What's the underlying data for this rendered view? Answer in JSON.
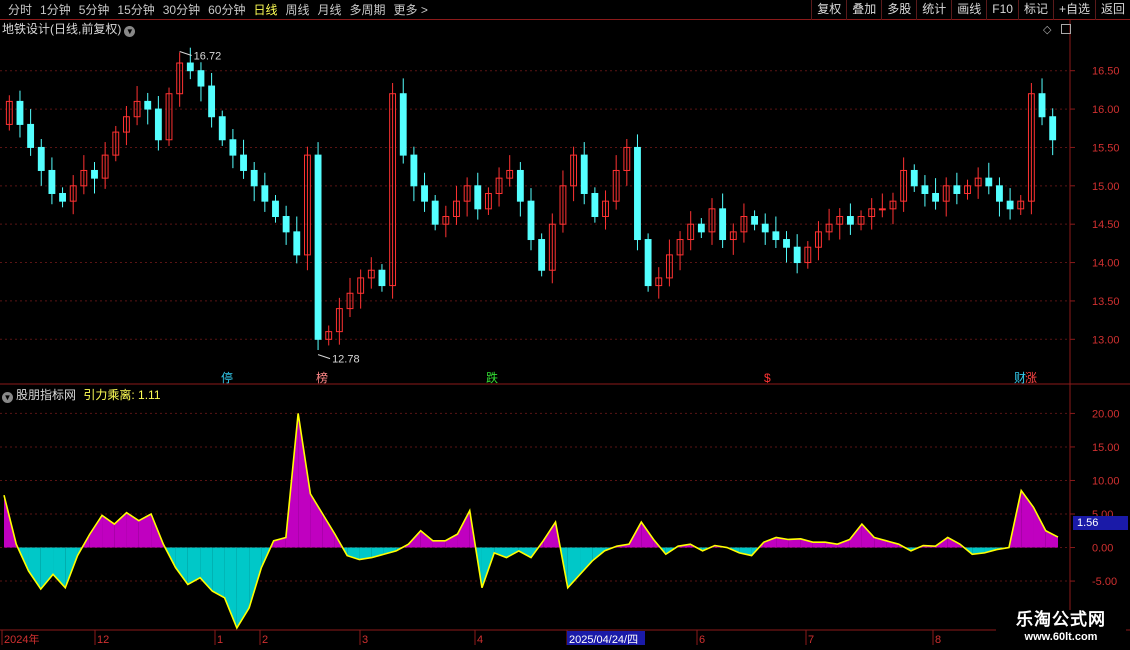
{
  "toolbar": {
    "period_tabs": [
      "分时",
      "1分钟",
      "5分钟",
      "15分钟",
      "30分钟",
      "60分钟",
      "日线",
      "周线",
      "月线",
      "多周期",
      "更多 >"
    ],
    "active_tab": "日线",
    "actions": [
      "复权",
      "叠加",
      "多股",
      "统计",
      "画线",
      "F10",
      "标记",
      "+自选",
      "返回"
    ]
  },
  "main_pane": {
    "title": "地铁设计(日线,前复权)",
    "price_ticks": [
      "16.50",
      "16.00",
      "15.50",
      "15.00",
      "14.50",
      "14.00",
      "13.50",
      "13.00"
    ],
    "high_marker": "16.72",
    "low_marker": "12.78",
    "event_markers": [
      {
        "text": "停",
        "color": "#33ccee"
      },
      {
        "text": "榜",
        "color": "#ff8888"
      },
      {
        "text": "跌",
        "color": "#33dd33"
      },
      {
        "text": "$",
        "color": "#ff3333"
      },
      {
        "text": "财",
        "color": "#33ccee"
      },
      {
        "text": "涨",
        "color": "#ff4444"
      }
    ],
    "colors": {
      "up": "#ff3232",
      "down": "#54ffff"
    }
  },
  "indicator_pane": {
    "source": "股朋指标网",
    "name": "引力乘离:",
    "value": "1.11",
    "current_box": "1.56",
    "ticks": [
      "20.00",
      "15.00",
      "10.00",
      "5.00",
      "0.00",
      "-5.00"
    ],
    "colors": {
      "positive_fill": "#c000c0",
      "negative_fill": "#00c8c8",
      "line": "#ffff00"
    }
  },
  "date_axis": {
    "labels": [
      "2024年",
      "12",
      "1",
      "2",
      "3",
      "4",
      "2025/04/24/四",
      "6",
      "7",
      "8"
    ]
  },
  "watermark": {
    "title": "乐淘公式网",
    "url": "www.60lt.com"
  },
  "chart_data": [
    {
      "type": "candlestick",
      "title": "地铁设计(日线,前复权)",
      "ylim": [
        12.6,
        16.9
      ],
      "series": [
        {
          "values": [
            16.1,
            15.8,
            15.5,
            15.2,
            14.9,
            14.8,
            15.0,
            15.2,
            15.1,
            15.4,
            15.7,
            15.9,
            16.1,
            16.0,
            15.6,
            16.2,
            16.6,
            16.5,
            16.3,
            15.9,
            15.6,
            15.4,
            15.2,
            15.0,
            14.8,
            14.6,
            14.4,
            14.1,
            15.4,
            13.0,
            13.1,
            13.4,
            13.6,
            13.8,
            13.9,
            13.7,
            16.2,
            15.4,
            15.0,
            14.8,
            14.5,
            14.6,
            14.8,
            15.0,
            14.7,
            14.9,
            15.1,
            15.2,
            14.8,
            14.3,
            13.9,
            14.5,
            15.0,
            15.4,
            14.9,
            14.6,
            14.8,
            15.2,
            15.5,
            14.3,
            13.7,
            13.8,
            14.1,
            14.3,
            14.5,
            14.4,
            14.7,
            14.3,
            14.4,
            14.6,
            14.5,
            14.4,
            14.3,
            14.2,
            14.0,
            14.2,
            14.4,
            14.5,
            14.6,
            14.5,
            14.6,
            14.7,
            14.7,
            14.8,
            15.2,
            15.0,
            14.9,
            14.8,
            15.0,
            14.9,
            15.0,
            15.1,
            15.0,
            14.8,
            14.7,
            14.8,
            16.2,
            15.9,
            15.6
          ]
        }
      ]
    },
    {
      "type": "area",
      "title": "引力乘离",
      "ylim": [
        -12,
        22
      ],
      "series": [
        {
          "name": "引力乘离",
          "values": [
            7.8,
            0.5,
            -3.5,
            -6.2,
            -4.0,
            -6.0,
            -1.2,
            2.0,
            4.8,
            3.5,
            5.2,
            4.0,
            5.0,
            0.5,
            -3.0,
            -5.5,
            -4.5,
            -6.5,
            -7.5,
            -12.0,
            -9.0,
            -3.0,
            1.0,
            1.5,
            20.0,
            8.0,
            5.0,
            2.0,
            -1.2,
            -1.8,
            -1.5,
            -1.0,
            -0.5,
            0.5,
            2.5,
            1.0,
            1.0,
            2.0,
            5.5,
            -6.0,
            -0.8,
            -1.5,
            -0.5,
            -1.5,
            1.0,
            3.8,
            -6.0,
            -4.0,
            -2.0,
            -0.5,
            0.2,
            0.5,
            3.8,
            1.2,
            -1.0,
            0.2,
            0.5,
            -0.5,
            0.3,
            0.0,
            -0.8,
            -1.2,
            0.8,
            1.5,
            1.2,
            1.3,
            0.8,
            0.8,
            0.5,
            1.2,
            3.5,
            1.5,
            1.0,
            0.5,
            -0.5,
            0.3,
            0.2,
            1.5,
            0.5,
            -1.0,
            -0.8,
            -0.3,
            0.0,
            8.5,
            6.0,
            2.5,
            1.56
          ]
        }
      ]
    }
  ]
}
